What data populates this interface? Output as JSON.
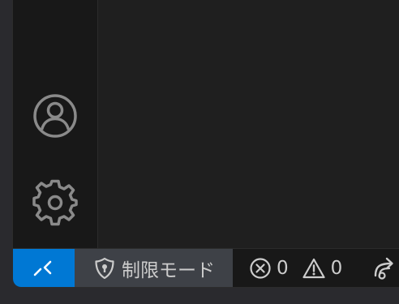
{
  "activity_bar": {
    "accounts_icon": "account-icon",
    "manage_icon": "gear-icon"
  },
  "status_bar": {
    "remote_icon": "remote-indicator-icon",
    "restricted_mode_label": "制限モード",
    "errors_count": "0",
    "warnings_count": "0",
    "ports_icon": "ports-forward-icon",
    "colors": {
      "remote_bg": "#0078d4",
      "restricted_bg": "#3e4147",
      "foreground": "#cccccc"
    }
  }
}
